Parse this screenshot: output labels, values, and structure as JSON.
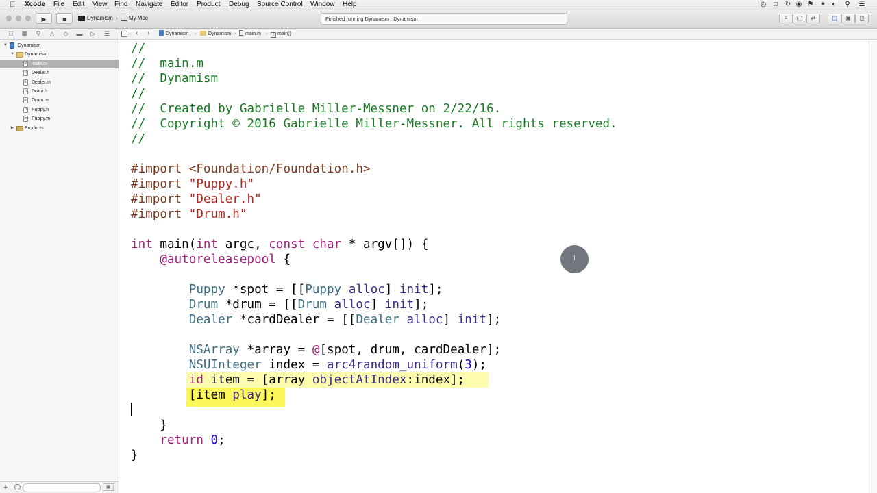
{
  "menubar": {
    "app_name": "Xcode",
    "items": [
      "File",
      "Edit",
      "View",
      "Find",
      "Navigate",
      "Editor",
      "Product",
      "Debug",
      "Source Control",
      "Window",
      "Help"
    ]
  },
  "toolbar": {
    "scheme_target": "Dynamism",
    "scheme_device": "My Mac",
    "activity_status": "Finished running Dynamism : Dynamism"
  },
  "navigator": {
    "items": [
      {
        "label": "Dynamism",
        "kind": "project",
        "level": 0,
        "expanded": true
      },
      {
        "label": "Dynamism",
        "kind": "folder",
        "level": 1,
        "expanded": true
      },
      {
        "label": "main.m",
        "kind": "file-m",
        "level": 2,
        "selected": true
      },
      {
        "label": "Dealer.h",
        "kind": "file-h",
        "level": 2
      },
      {
        "label": "Dealer.m",
        "kind": "file-m",
        "level": 2
      },
      {
        "label": "Drum.h",
        "kind": "file-h",
        "level": 2
      },
      {
        "label": "Drum.m",
        "kind": "file-m",
        "level": 2
      },
      {
        "label": "Puppy.h",
        "kind": "file-h",
        "level": 2
      },
      {
        "label": "Puppy.m",
        "kind": "file-m",
        "level": 2
      },
      {
        "label": "Products",
        "kind": "products",
        "level": 1,
        "expanded": false
      }
    ]
  },
  "jumpbar": {
    "crumbs": [
      "Dynamism",
      "Dynamism",
      "main.m",
      "main()"
    ]
  },
  "editor": {
    "lines": [
      "//",
      "//  main.m",
      "//  Dynamism",
      "//",
      "//  Created by Gabrielle Miller-Messner on 2/22/16.",
      "//  Copyright © 2016 Gabrielle Miller-Messner. All rights reserved.",
      "//",
      "",
      "#import <Foundation/Foundation.h>",
      "#import \"Puppy.h\"",
      "#import \"Dealer.h\"",
      "#import \"Drum.h\"",
      "",
      "int main(int argc, const char * argv[]) {",
      "    @autoreleasepool {",
      "",
      "        Puppy *spot = [[Puppy alloc] init];",
      "        Drum *drum = [[Drum alloc] init];",
      "        Dealer *cardDealer = [[Dealer alloc] init];",
      "",
      "        NSArray *array = @[spot, drum, cardDealer];",
      "        NSUInteger index = arc4random_uniform(3);",
      "        id item = [array objectAtIndex:index];",
      "        [item play];",
      "",
      "    }",
      "    return 0;",
      "}"
    ]
  },
  "colors": {
    "comment": "#1c7c26",
    "preprocessor": "#7a3e24",
    "string": "#b3261e",
    "keyword": "#a3207e",
    "type": "#3d6e82",
    "method": "#3e2a8a",
    "number": "#1a00c8",
    "highlight": "#fdfbae",
    "highlight_strong": "#fbf65a"
  }
}
